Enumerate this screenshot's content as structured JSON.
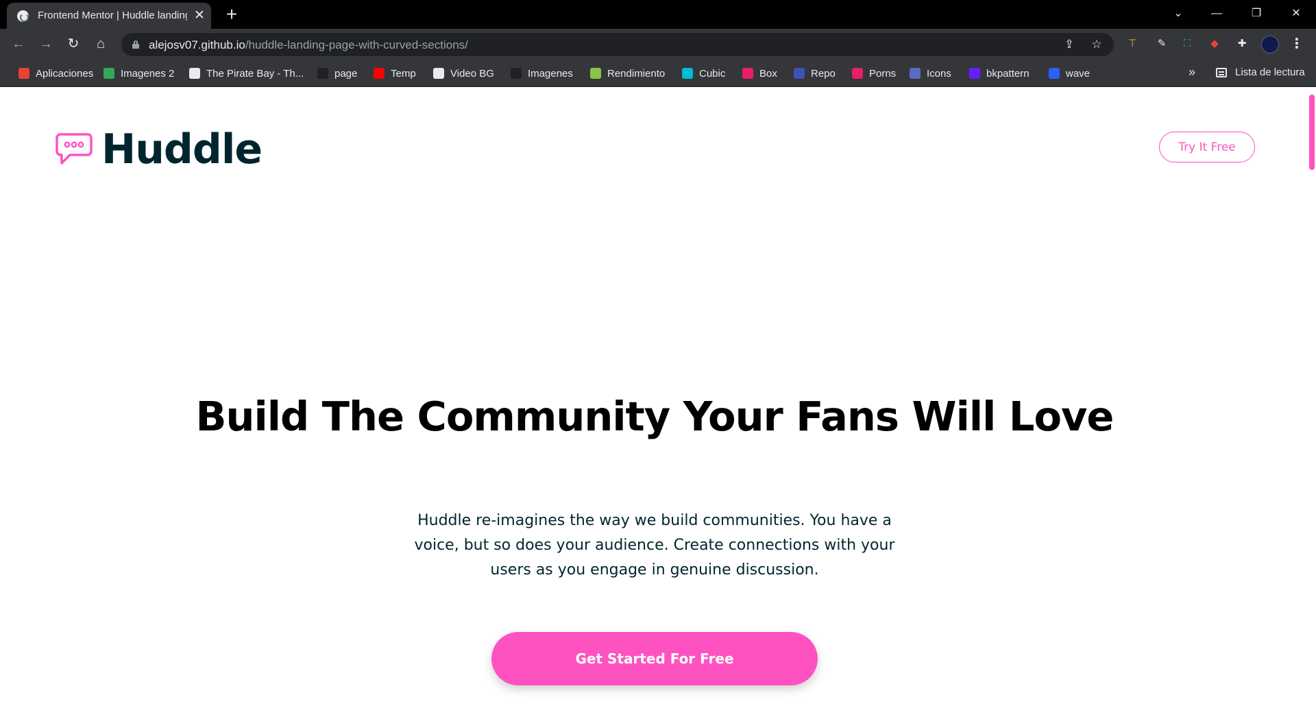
{
  "browser": {
    "tab_title": "Frontend Mentor | Huddle landing",
    "tab_close": "✕",
    "new_tab": "+",
    "window_controls": {
      "tab_search": "⌄",
      "minimize": "—",
      "restore": "❐",
      "close": "✕"
    },
    "url_host": "alejosv07.github.io",
    "url_path": "/huddle-landing-page-with-curved-sections/",
    "nav": {
      "back": "←",
      "forward": "→",
      "reload": "↻",
      "home": "⌂"
    },
    "bookmarks": [
      {
        "label": "Aplicaciones",
        "icon": "apps-grid-icon",
        "color": "#ea4335"
      },
      {
        "label": "Imagenes 2",
        "icon": "image-icon",
        "color": "#34a853"
      },
      {
        "label": "The Pirate Bay - Th...",
        "icon": "pirate-bay-icon",
        "color": "#e8eaed"
      },
      {
        "label": "page",
        "icon": "w-icon",
        "color": "#202124"
      },
      {
        "label": "Temp",
        "icon": "youtube-icon",
        "color": "#ff0000"
      },
      {
        "label": "Video BG",
        "icon": "c-icon",
        "color": "#e8eaed"
      },
      {
        "label": "Imagenes",
        "icon": "unsplash-icon",
        "color": "#202124"
      },
      {
        "label": "Rendimiento",
        "icon": "rendimiento-icon",
        "color": "#8bc34a"
      },
      {
        "label": "Cubic",
        "icon": "cubic-icon",
        "color": "#00bcd4"
      },
      {
        "label": "Box",
        "icon": "box-icon",
        "color": "#e91e63"
      },
      {
        "label": "Repo",
        "icon": "repo-icon",
        "color": "#3f51b5"
      },
      {
        "label": "Porns",
        "icon": "porns-icon",
        "color": "#e91e63"
      },
      {
        "label": "Icons",
        "icon": "icons-icon",
        "color": "#5c6bc0"
      },
      {
        "label": "bkpattern",
        "icon": "bkpattern-icon",
        "color": "#651fff"
      },
      {
        "label": "wave",
        "icon": "wave-icon",
        "color": "#2962ff"
      }
    ],
    "bookmarks_overflow": "»",
    "reading_list": "Lista de lectura"
  },
  "page": {
    "brand": "Huddle",
    "try_button": "Try It Free",
    "hero_title": "Build The Community Your Fans Will Love",
    "hero_text": "Huddle re-imagines the way we build communities. You have a voice, but so does your audience. Create connections with your users as you engage in genuine discussion.",
    "cta_button": "Get Started For Free"
  },
  "colors": {
    "accent_pink": "#ff52c1",
    "dark_cyan": "#00252e",
    "chrome_dark": "#35363a"
  }
}
